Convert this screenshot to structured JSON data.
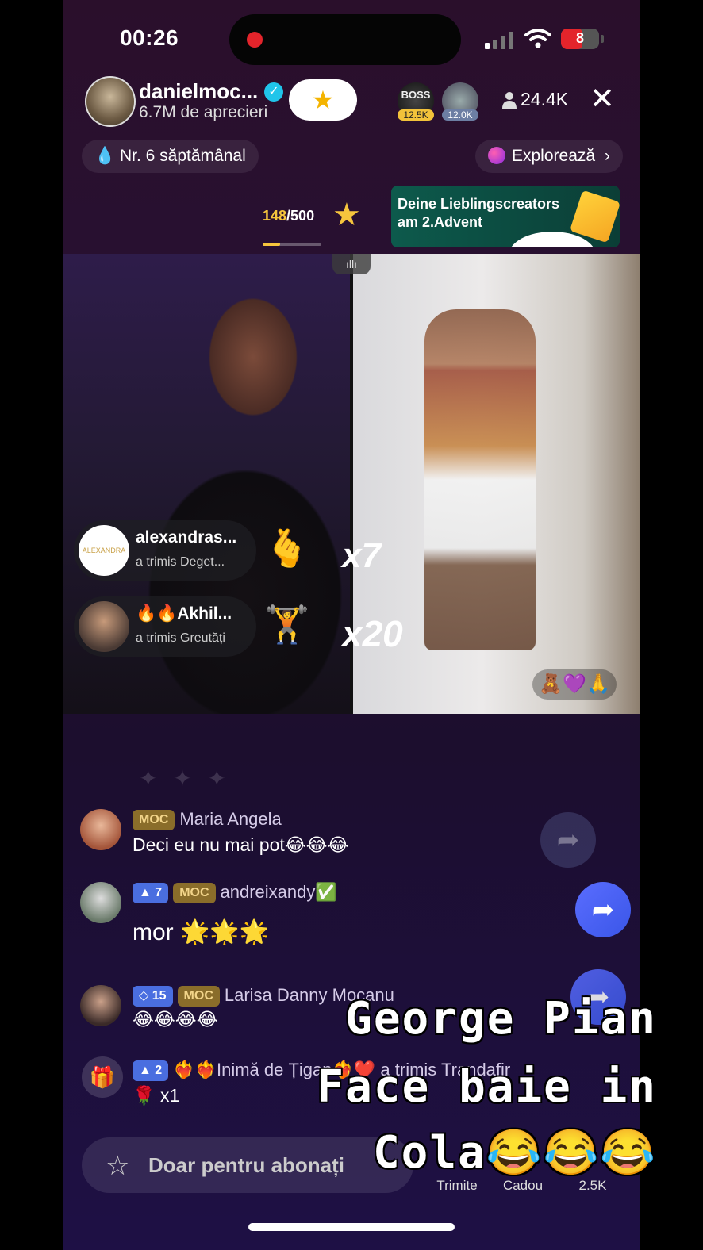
{
  "status_bar": {
    "time": "00:26",
    "battery": "8"
  },
  "host": {
    "name": "danielmoc...",
    "likes": "6.7M de aprecieri"
  },
  "top_badges": [
    {
      "label": "BOSS",
      "value": "12.5K"
    },
    {
      "value": "12.0K"
    }
  ],
  "viewers": "24.4K",
  "weekly_rank": "Nr. 6 săptămânal",
  "explore_label": "Explorează",
  "goal": {
    "current": "148",
    "total": "/500",
    "progress": 0.296
  },
  "promo_banner": "Deine Lieblingscreators am 2.Advent",
  "gifts": [
    {
      "user": "alexandras...",
      "message": "a trimis Deget...",
      "multiplier": "x7",
      "avatar_text": "ALEXANDRA"
    },
    {
      "user": "🔥🔥Akhil...",
      "message": "a trimis Greutăți",
      "multiplier": "x20"
    }
  ],
  "video_right_emojis": "🧸💜🙏",
  "chat": [
    {
      "badges": [
        {
          "text": "MOC",
          "type": "gold"
        }
      ],
      "user": "Maria Angela",
      "text": "Deci eu nu mai pot😂😂😂"
    },
    {
      "badges": [
        {
          "text": "7",
          "type": "blue"
        },
        {
          "text": "MOC",
          "type": "gold"
        }
      ],
      "user": "andreixandy✅",
      "text": "mor 🌟🌟🌟"
    },
    {
      "badges": [
        {
          "text": "15",
          "type": "blue"
        },
        {
          "text": "MOC",
          "type": "gold"
        }
      ],
      "user": "Larisa Danny Mocanu",
      "text": "😂😂😂😂"
    },
    {
      "badges": [
        {
          "text": "2",
          "type": "blue"
        }
      ],
      "user": "❤️‍🔥❤️‍🔥Inimă de Țigan❤️‍🔥❤️",
      "action": "a trimis Trandafir",
      "text": "🌹 x1"
    }
  ],
  "subscriber_placeholder": "Doar pentru abonați",
  "bottom_actions": {
    "send": "Trimite",
    "gift": "Cadou",
    "likes": "2.5K"
  },
  "caption_lines": [
    "George Pian",
    "Face baie in",
    "Cola😂😂😂"
  ],
  "colors": {
    "accent_gold": "#f6c53d",
    "share_blue": "#4a64f0",
    "verified": "#20c5ea"
  }
}
